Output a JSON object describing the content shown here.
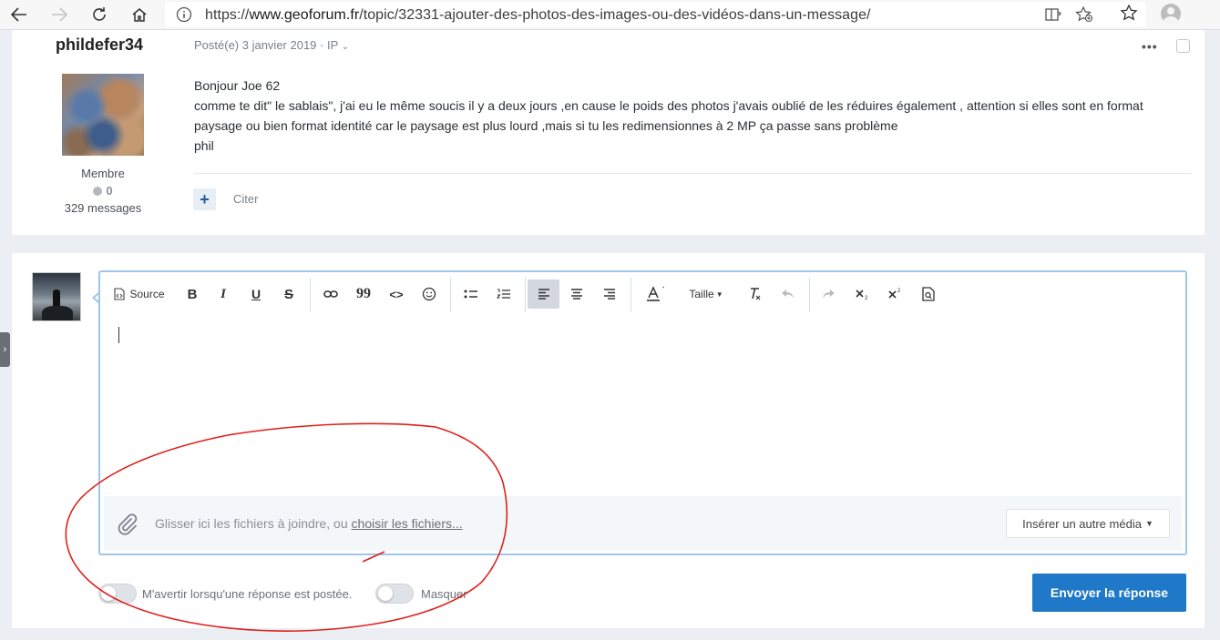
{
  "browser": {
    "url_prefix": "https://",
    "url_host": "www.geoforum.fr",
    "url_path": "/topic/32331-ajouter-des-photos-des-images-ou-des-vidéos-dans-un-message/"
  },
  "post": {
    "author": "phildefer34",
    "role": "Membre",
    "reputation": "0",
    "posts_count": "329 messages",
    "date": "Posté(e) 3 janvier 2019 · IP",
    "menu": "•••",
    "body": [
      "Bonjour Joe 62",
      "comme te dit\" le sablais\", j'ai eu le même soucis il y a deux jours ,en cause le poids des photos j'avais oublié de les réduires également , attention si elles sont en format paysage ou bien format identité car le paysage est plus lourd  ,mais si tu les redimensionnes à 2 MP ça passe sans problème",
      "phil"
    ],
    "plus": "+",
    "quote": "Citer"
  },
  "editor": {
    "toolbar": {
      "source": "Source",
      "bold": "B",
      "italic": "I",
      "underline": "U",
      "strike": "S",
      "quote": "99",
      "code": "<>",
      "size": "Taille"
    },
    "drop_text": "Glisser ici les fichiers à joindre, ou ",
    "drop_link": "choisir les fichiers...",
    "insert_media": "Insérer un autre média"
  },
  "reply": {
    "notify_label": "M'avertir lorsqu'une réponse est postée.",
    "hide_label": "Masquer",
    "submit": "Envoyer la réponse"
  },
  "colors": {
    "accent": "#1f78c8",
    "annotation": "#e0201c"
  }
}
